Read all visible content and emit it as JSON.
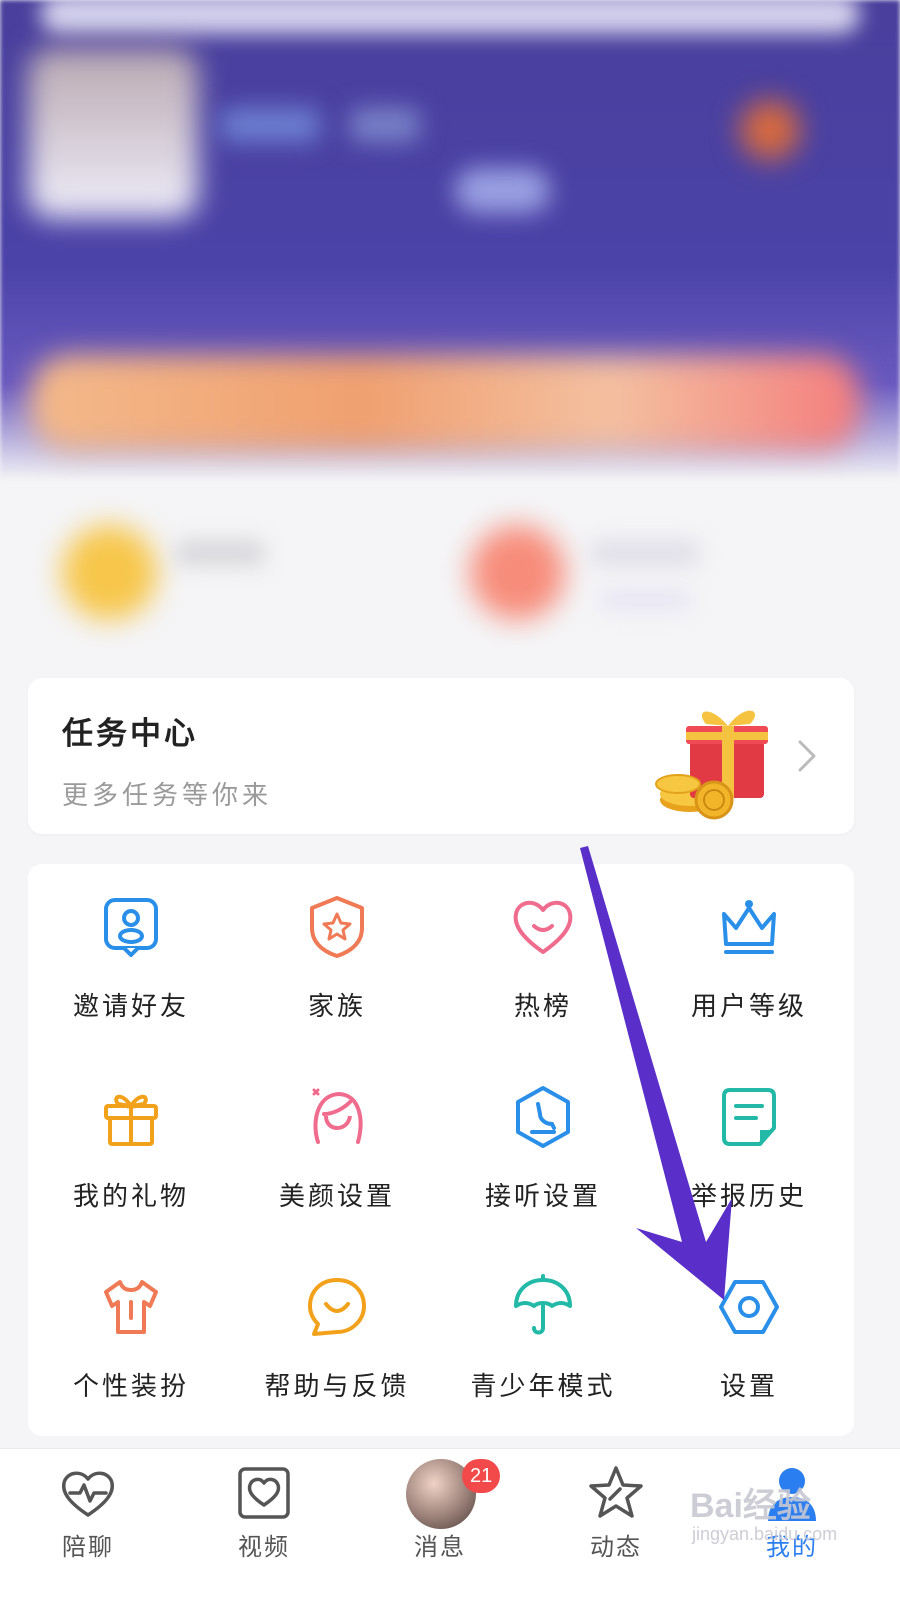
{
  "task_center": {
    "title": "任务中心",
    "subtitle": "更多任务等你来"
  },
  "menu_items": [
    {
      "label": "邀请好友",
      "icon": "invite-friend-icon",
      "color": "#2a8fe8"
    },
    {
      "label": "家族",
      "icon": "family-shield-icon",
      "color": "#ef7a55"
    },
    {
      "label": "热榜",
      "icon": "heart-icon",
      "color": "#f06c8e"
    },
    {
      "label": "用户等级",
      "icon": "crown-icon",
      "color": "#2a8fe8"
    },
    {
      "label": "我的礼物",
      "icon": "gift-box-icon",
      "color": "#f2a21a"
    },
    {
      "label": "美颜设置",
      "icon": "beauty-girl-icon",
      "color": "#f06c8e"
    },
    {
      "label": "接听设置",
      "icon": "phone-hexagon-icon",
      "color": "#2a8fe8"
    },
    {
      "label": "举报历史",
      "icon": "report-note-icon",
      "color": "#22b9a7"
    },
    {
      "label": "个性装扮",
      "icon": "tshirt-icon",
      "color": "#ef7a55"
    },
    {
      "label": "帮助与反馈",
      "icon": "chat-smile-icon",
      "color": "#f2a21a"
    },
    {
      "label": "青少年模式",
      "icon": "umbrella-icon",
      "color": "#22b9a7"
    },
    {
      "label": "设置",
      "icon": "settings-hexagon-icon",
      "color": "#2a8fe8"
    }
  ],
  "bottom_nav": [
    {
      "label": "陪聊",
      "icon": "heartbeat-icon"
    },
    {
      "label": "视频",
      "icon": "video-heart-icon"
    },
    {
      "label": "消息",
      "icon": "message-avatar",
      "badge": "21"
    },
    {
      "label": "动态",
      "icon": "star-icon"
    },
    {
      "label": "我的",
      "icon": "profile-icon",
      "active": true
    }
  ],
  "watermark": {
    "line1": "Bai经验",
    "line2": "jingyan.baidu.com"
  },
  "colors": {
    "accent_blue": "#2a7ef0",
    "annotation_arrow": "#5a2fc9",
    "badge_red": "#f24a4a"
  }
}
